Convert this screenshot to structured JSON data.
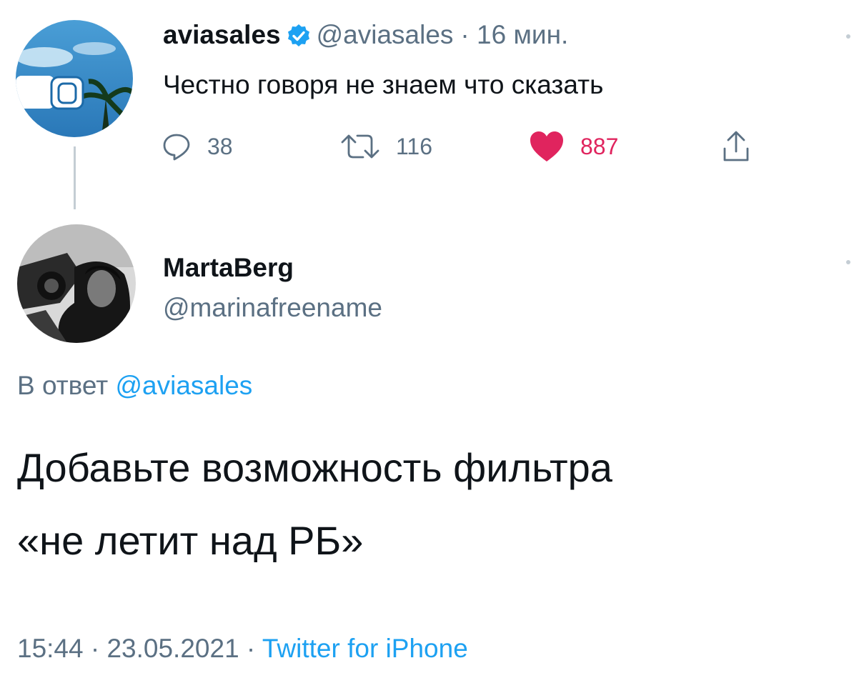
{
  "tweet": {
    "name": "aviasales",
    "handle": "@aviasales",
    "time": "· 16 мин.",
    "text": "Честно говоря не знаем что сказать",
    "replies": "38",
    "retweets": "116",
    "likes": "887",
    "icons": [
      "reply-icon",
      "retweet-icon",
      "heart-icon",
      "share-icon",
      "verified-icon"
    ]
  },
  "reply": {
    "name": "MartaBerg",
    "handle": "@marinafreename",
    "reply_to_prefix": "В ответ ",
    "reply_to_handle": "@aviasales",
    "text_line1": "Добавьте возможность фильтра",
    "text_line2": "«не летит над РБ»",
    "timestamp": "15:44 · 23.05.2021 · ",
    "source": "Twitter for iPhone"
  },
  "colors": {
    "link": "#1da1f2",
    "secondary": "#5b7083",
    "like": "#e0245e",
    "text": "#0f1419"
  }
}
